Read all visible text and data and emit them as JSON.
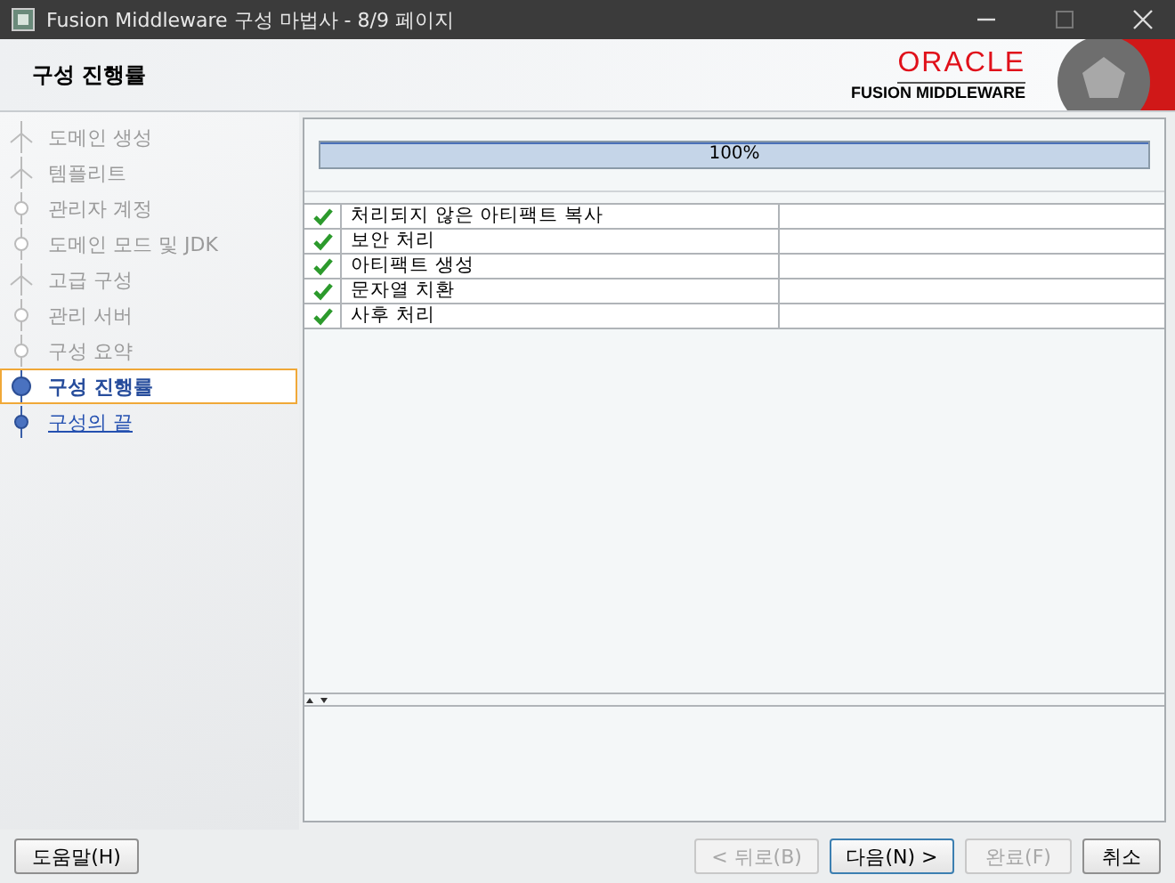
{
  "window": {
    "title": "Fusion Middleware 구성 마법사 - 8/9 페이지"
  },
  "header": {
    "title": "구성 진행률",
    "logo_brand": "ORACLE",
    "logo_product": "FUSION MIDDLEWARE"
  },
  "steps": [
    {
      "label": "도메인 생성",
      "kind": "branch",
      "completed": true,
      "selected": false
    },
    {
      "label": "템플리트",
      "kind": "branch",
      "completed": true,
      "selected": false
    },
    {
      "label": "관리자 계정",
      "kind": "node",
      "completed": true,
      "selected": false
    },
    {
      "label": "도메인 모드 및 JDK",
      "kind": "node",
      "completed": true,
      "selected": false
    },
    {
      "label": "고급 구성",
      "kind": "branch",
      "completed": true,
      "selected": false
    },
    {
      "label": "관리 서버",
      "kind": "node",
      "completed": true,
      "selected": false
    },
    {
      "label": "구성 요약",
      "kind": "node",
      "completed": true,
      "selected": false
    },
    {
      "label": "구성 진행률",
      "kind": "node",
      "completed": false,
      "selected": true
    },
    {
      "label": "구성의 끝",
      "kind": "node",
      "completed": false,
      "selected": false
    }
  ],
  "progress": {
    "level": 1,
    "reading": "100%"
  },
  "tasks": [
    {
      "label": "처리되지 않은 아티팩트 복사",
      "done": true
    },
    {
      "label": "보안 처리",
      "done": true
    },
    {
      "label": "아티팩트 생성",
      "done": true
    },
    {
      "label": "문자열 치환",
      "done": true
    },
    {
      "label": "사후 처리",
      "done": true
    }
  ],
  "buttons": [
    {
      "label": "도움말(H)",
      "disabled": false
    },
    {
      "label": "< 뒤로(B)",
      "disabled": true
    },
    {
      "label": "다음(N) >",
      "disabled": false
    },
    {
      "label": "완료(F)",
      "disabled": true
    },
    {
      "label": "취소",
      "disabled": false
    }
  ]
}
